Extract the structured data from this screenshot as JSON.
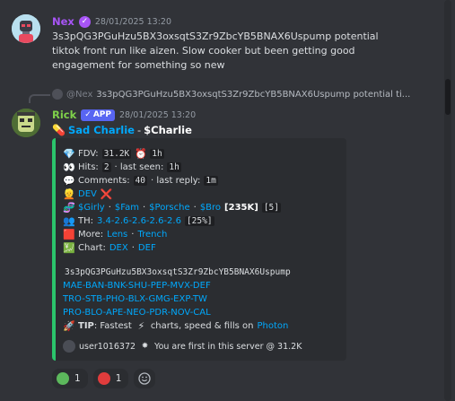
{
  "msg1": {
    "username": "Nex",
    "timestamp": "28/01/2025 13:20",
    "text_line1": "3s3pQG3PGuHzu5BX3oxsqtS3Zr9ZbcYB5BNAX6Uspump potential",
    "text_line2": "tiktok front run like aizen. Slow cooker but been getting good",
    "text_line3": "engagement for something so new"
  },
  "reply": {
    "username": "@Nex",
    "text": "3s3pQG3PGuHzu5BX3oxsqtS3Zr9ZbcYB5BNAX6Uspump potential ti..."
  },
  "msg2": {
    "username": "Rick",
    "app_badge": "APP",
    "timestamp": "28/01/2025 13:20",
    "title_name": "Sad Charlie",
    "title_sep": " - ",
    "title_ticker": "$Charlie"
  },
  "embed": {
    "fdv_label": "FDV:",
    "fdv_value": "31.2K",
    "fdv_age": "1h",
    "hits_label": "Hits:",
    "hits_value": "2",
    "hits_sep": "· last seen:",
    "hits_seen": "1h",
    "comments_label": "Comments:",
    "comments_value": "40",
    "comments_sep": "· last reply:",
    "comments_reply": "1m",
    "dev_label": "DEV",
    "related_1": "$Girly",
    "related_2": "$Fam",
    "related_3": "$Porsche",
    "related_4": "$Bro",
    "related_mc": "[235K]",
    "related_count": "[5]",
    "th_label": "TH:",
    "th_values": "3.4-2.6-2.6-2.6-2.6",
    "th_pct": "[25%]",
    "more_label": "More:",
    "more_1": "Lens",
    "more_2": "Trench",
    "chart_label": "Chart:",
    "chart_1": "DEX",
    "chart_2": "DEF",
    "contract": "3s3pQG3PGuHzu5BX3oxsqtS3Zr9ZbcYB5BNAX6Uspump",
    "links_1": "MAE-BAN-BNK-SHU-PEP-MVX-DEF",
    "links_2": "TRO-STB-PHO-BLX-GMG-EXP-TW",
    "links_3": "PRO-BLO-APE-NEO-PDR-NOV-CAL",
    "tip_label": "TIP",
    "tip_text1": ": Fastest",
    "tip_text2": "charts, speed & fills on",
    "tip_link": "Photon",
    "footer_user": "user1016372",
    "footer_text": "You are first in this server @ 31.2K"
  },
  "reactions": [
    {
      "count": "1",
      "color": "#5cb85c"
    },
    {
      "count": "1",
      "color": "#e03c3c"
    }
  ],
  "colors": {
    "accent": "#2bc46b",
    "link": "#00a8fc",
    "nex_name": "#a855f7",
    "rick_name": "#7fd24a"
  }
}
